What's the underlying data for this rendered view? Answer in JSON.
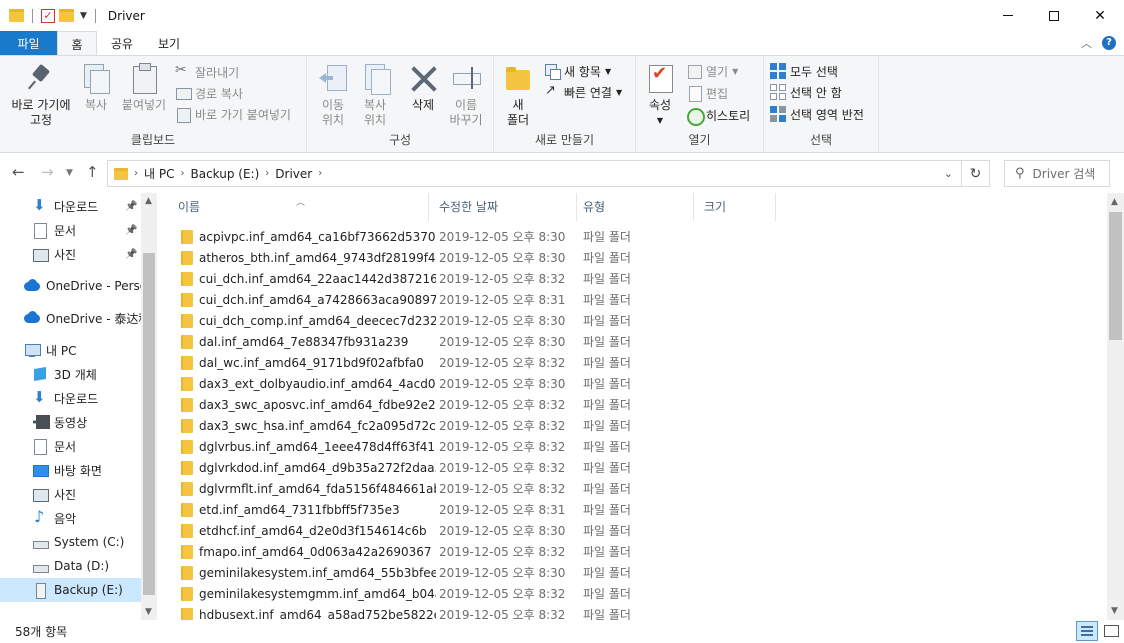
{
  "window": {
    "title": "Driver"
  },
  "ribbon_tabs": [
    "파일",
    "홈",
    "공유",
    "보기"
  ],
  "ribbon": {
    "clipboard": {
      "pin_label": "바로 가기에\n고정",
      "copy_label": "복사",
      "paste_label": "붙여넣기",
      "cut_label": "잘라내기",
      "copy_path_label": "경로 복사",
      "paste_shortcut_label": "바로 가기 붙여넣기",
      "group_label": "클립보드"
    },
    "organize": {
      "move_to_label": "이동\n위치",
      "copy_to_label": "복사\n위치",
      "delete_label": "삭제",
      "rename_label": "이름\n바꾸기",
      "group_label": "구성"
    },
    "new": {
      "new_folder_label": "새\n폴더",
      "new_item_label": "새 항목",
      "easy_access_label": "빠른 연결",
      "group_label": "새로 만들기"
    },
    "open": {
      "properties_label": "속성",
      "open_label": "열기",
      "edit_label": "편집",
      "history_label": "히스토리",
      "group_label": "열기"
    },
    "select": {
      "select_all_label": "모두 선택",
      "select_none_label": "선택 안 함",
      "invert_label": "선택 영역 반전",
      "group_label": "선택"
    }
  },
  "address": {
    "crumbs": [
      "내 PC",
      "Backup (E:)",
      "Driver"
    ],
    "search_placeholder": "Driver 검색"
  },
  "nav_pane": [
    {
      "label": "다운로드",
      "icon": "download-icon",
      "pinned": true
    },
    {
      "label": "문서",
      "icon": "document-icon",
      "pinned": true
    },
    {
      "label": "사진",
      "icon": "pictures-icon",
      "pinned": true
    },
    {
      "label": "OneDrive - Personal",
      "icon": "onedrive-icon",
      "pinned": false
    },
    {
      "label": "OneDrive - 泰达科技",
      "icon": "onedrive-icon",
      "pinned": false
    },
    {
      "label": "내 PC",
      "icon": "pc-icon",
      "pinned": false
    },
    {
      "label": "3D 개체",
      "icon": "3d-objects-icon",
      "pinned": false
    },
    {
      "label": "다운로드",
      "icon": "download-icon",
      "pinned": false
    },
    {
      "label": "동영상",
      "icon": "video-icon",
      "pinned": false
    },
    {
      "label": "문서",
      "icon": "document-icon",
      "pinned": false
    },
    {
      "label": "바탕 화면",
      "icon": "desktop-icon",
      "pinned": false
    },
    {
      "label": "사진",
      "icon": "pictures-icon",
      "pinned": false
    },
    {
      "label": "음악",
      "icon": "music-icon",
      "pinned": false
    },
    {
      "label": "System (C:)",
      "icon": "system-drive-icon",
      "pinned": false
    },
    {
      "label": "Data (D:)",
      "icon": "drive-icon",
      "pinned": false
    },
    {
      "label": "Backup (E:)",
      "icon": "usb-drive-icon",
      "pinned": false,
      "selected": true
    }
  ],
  "columns": [
    "이름",
    "수정한 날짜",
    "유형",
    "크기"
  ],
  "files": [
    {
      "name": "acpivpc.inf_amd64_ca16bf73662d5370",
      "date": "2019-12-05 오후 8:30",
      "type": "파일 폴더"
    },
    {
      "name": "atheros_bth.inf_amd64_9743df28199f4...",
      "date": "2019-12-05 오후 8:30",
      "type": "파일 폴더"
    },
    {
      "name": "cui_dch.inf_amd64_22aac1442d387216",
      "date": "2019-12-05 오후 8:32",
      "type": "파일 폴더"
    },
    {
      "name": "cui_dch.inf_amd64_a7428663aca90897",
      "date": "2019-12-05 오후 8:31",
      "type": "파일 폴더"
    },
    {
      "name": "cui_dch_comp.inf_amd64_deecec7d232...",
      "date": "2019-12-05 오후 8:30",
      "type": "파일 폴더"
    },
    {
      "name": "dal.inf_amd64_7e88347fb931a239",
      "date": "2019-12-05 오후 8:30",
      "type": "파일 폴더"
    },
    {
      "name": "dal_wc.inf_amd64_9171bd9f02afbfa0",
      "date": "2019-12-05 오후 8:32",
      "type": "파일 폴더"
    },
    {
      "name": "dax3_ext_dolbyaudio.inf_amd64_4acd06...",
      "date": "2019-12-05 오후 8:30",
      "type": "파일 폴더"
    },
    {
      "name": "dax3_swc_aposvc.inf_amd64_fdbe92e20...",
      "date": "2019-12-05 오후 8:32",
      "type": "파일 폴더"
    },
    {
      "name": "dax3_swc_hsa.inf_amd64_fc2a095d72cd...",
      "date": "2019-12-05 오후 8:32",
      "type": "파일 폴더"
    },
    {
      "name": "dglvrbus.inf_amd64_1eee478d4ff63f41",
      "date": "2019-12-05 오후 8:32",
      "type": "파일 폴더"
    },
    {
      "name": "dglvrkdod.inf_amd64_d9b35a272f2daa3a",
      "date": "2019-12-05 오후 8:32",
      "type": "파일 폴더"
    },
    {
      "name": "dglvrmflt.inf_amd64_fda5156f484661ab",
      "date": "2019-12-05 오후 8:32",
      "type": "파일 폴더"
    },
    {
      "name": "etd.inf_amd64_7311fbbff5f735e3",
      "date": "2019-12-05 오후 8:31",
      "type": "파일 폴더"
    },
    {
      "name": "etdhcf.inf_amd64_d2e0d3f154614c6b",
      "date": "2019-12-05 오후 8:30",
      "type": "파일 폴더"
    },
    {
      "name": "fmapo.inf_amd64_0d063a42a2690367",
      "date": "2019-12-05 오후 8:32",
      "type": "파일 폴더"
    },
    {
      "name": "geminilakesystem.inf_amd64_55b3bfee...",
      "date": "2019-12-05 오후 8:30",
      "type": "파일 폴더"
    },
    {
      "name": "geminilakesystemgmm.inf_amd64_b04a...",
      "date": "2019-12-05 오후 8:32",
      "type": "파일 폴더"
    },
    {
      "name": "hdbusext.inf_amd64_a58ad752be5822ed",
      "date": "2019-12-05 오후 8:32",
      "type": "파일 폴더"
    }
  ],
  "status": {
    "item_count": "58개 항목"
  }
}
